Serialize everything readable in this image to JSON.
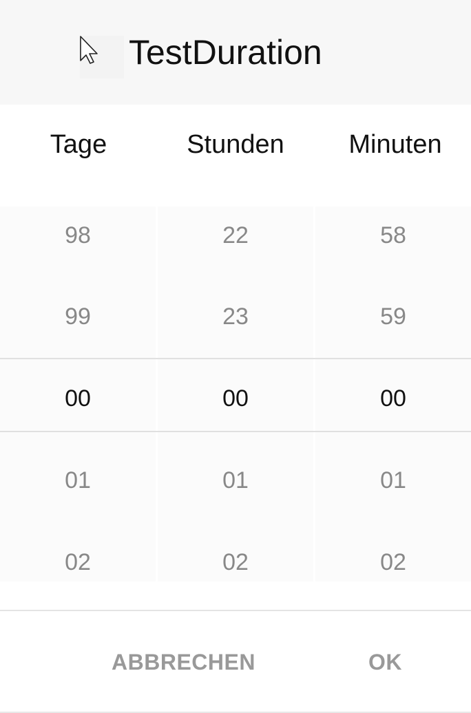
{
  "dialog": {
    "title": "TestDuration",
    "columns": {
      "days": "Tage",
      "hours": "Stunden",
      "minutes": "Minuten"
    },
    "wheels": {
      "days": [
        "98",
        "99",
        "00",
        "01",
        "02"
      ],
      "hours": [
        "22",
        "23",
        "00",
        "01",
        "02"
      ],
      "minutes": [
        "58",
        "59",
        "00",
        "01",
        "02"
      ]
    },
    "selected": {
      "days": "00",
      "hours": "00",
      "minutes": "00"
    },
    "buttons": {
      "cancel": "ABBRECHEN",
      "ok": "OK"
    },
    "icons": {
      "header": "cursor-arrow-icon"
    },
    "colors": {
      "header_bg": "#f7f7f7",
      "selected_text": "#111111",
      "unselected_text": "#888888",
      "button_text": "#999999"
    }
  }
}
